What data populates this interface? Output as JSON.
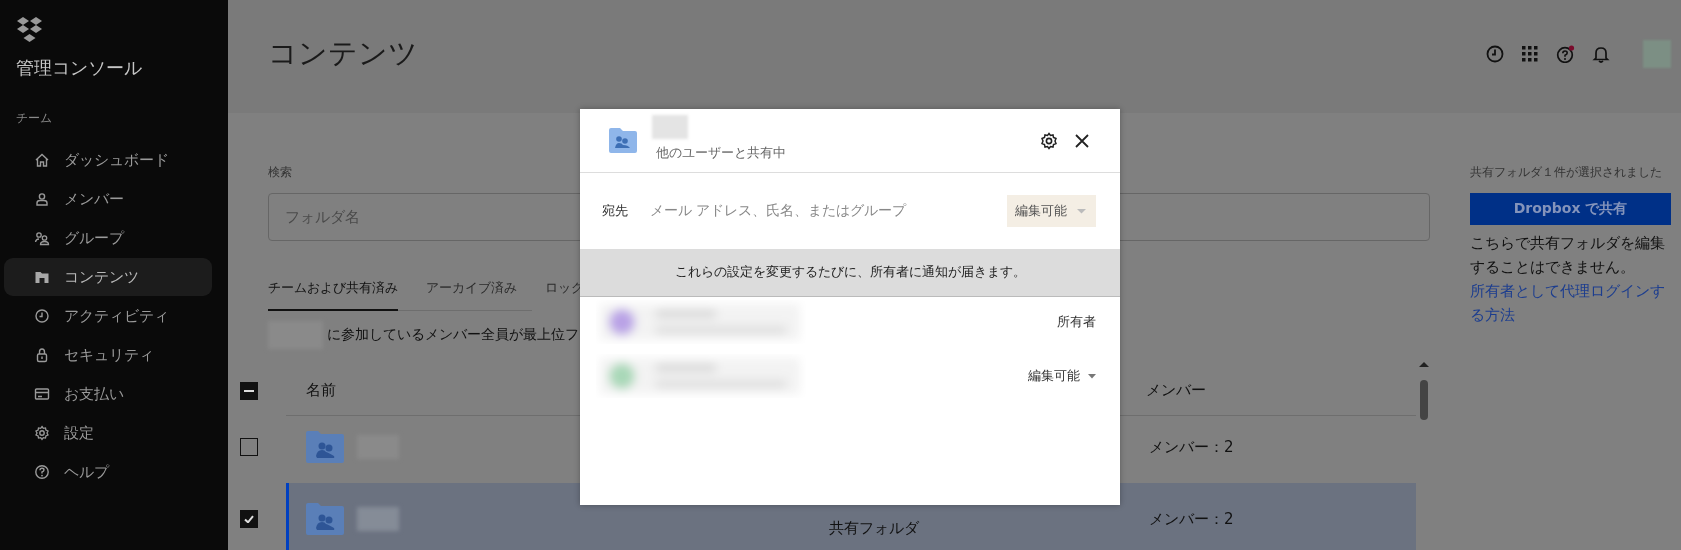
{
  "sidebar": {
    "title": "管理コンソール",
    "section": "チーム",
    "items": [
      {
        "label": "ダッシュボード",
        "selected": false
      },
      {
        "label": "メンバー",
        "selected": false
      },
      {
        "label": "グループ",
        "selected": false
      },
      {
        "label": "コンテンツ",
        "selected": true
      },
      {
        "label": "アクティビティ",
        "selected": false
      },
      {
        "label": "セキュリティ",
        "selected": false
      },
      {
        "label": "お支払い",
        "selected": false
      },
      {
        "label": "設定",
        "selected": false
      },
      {
        "label": "ヘルプ",
        "selected": false
      }
    ]
  },
  "header": {
    "title": "コンテンツ"
  },
  "search": {
    "label": "検索",
    "placeholder": "フォルダ名"
  },
  "tabs": [
    {
      "label": "チームおよび共有済み",
      "selected": true
    },
    {
      "label": "アーカイブ済み",
      "selected": false
    },
    {
      "label": "ロック",
      "selected": false
    }
  ],
  "notice": "に参加しているメンバー全員が最上位フ",
  "table": {
    "columns": [
      "名前",
      "メンバー"
    ],
    "header_checkbox": {
      "indeterminate": true
    },
    "rows": [
      {
        "members": "メンバー：2",
        "checked": false,
        "selected": false
      },
      {
        "type": "共有フォルダ",
        "members": "メンバー：2",
        "checked": true,
        "selected": true
      }
    ]
  },
  "side_panel": {
    "status": "共有フォルダ１件が選択されました",
    "button": "Dropbox で共有",
    "message": "こちらで共有フォルダを編集することはできません。",
    "link": "所有者として代理ログインする方法"
  },
  "share_dialog": {
    "subtitle": "他のユーザーと共有中",
    "to_label": "宛先",
    "placeholder": "メール アドレス、氏名、またはグループ",
    "permission": "編集可能",
    "notice": "これらの設定を変更するたびに、所有者に通知が届きます。",
    "members": [
      {
        "role": "所有者",
        "kind": "fixed",
        "color": "#b9a2e6"
      },
      {
        "role": "編集可能",
        "kind": "dropdown",
        "color": "#a9d8b8"
      }
    ]
  }
}
